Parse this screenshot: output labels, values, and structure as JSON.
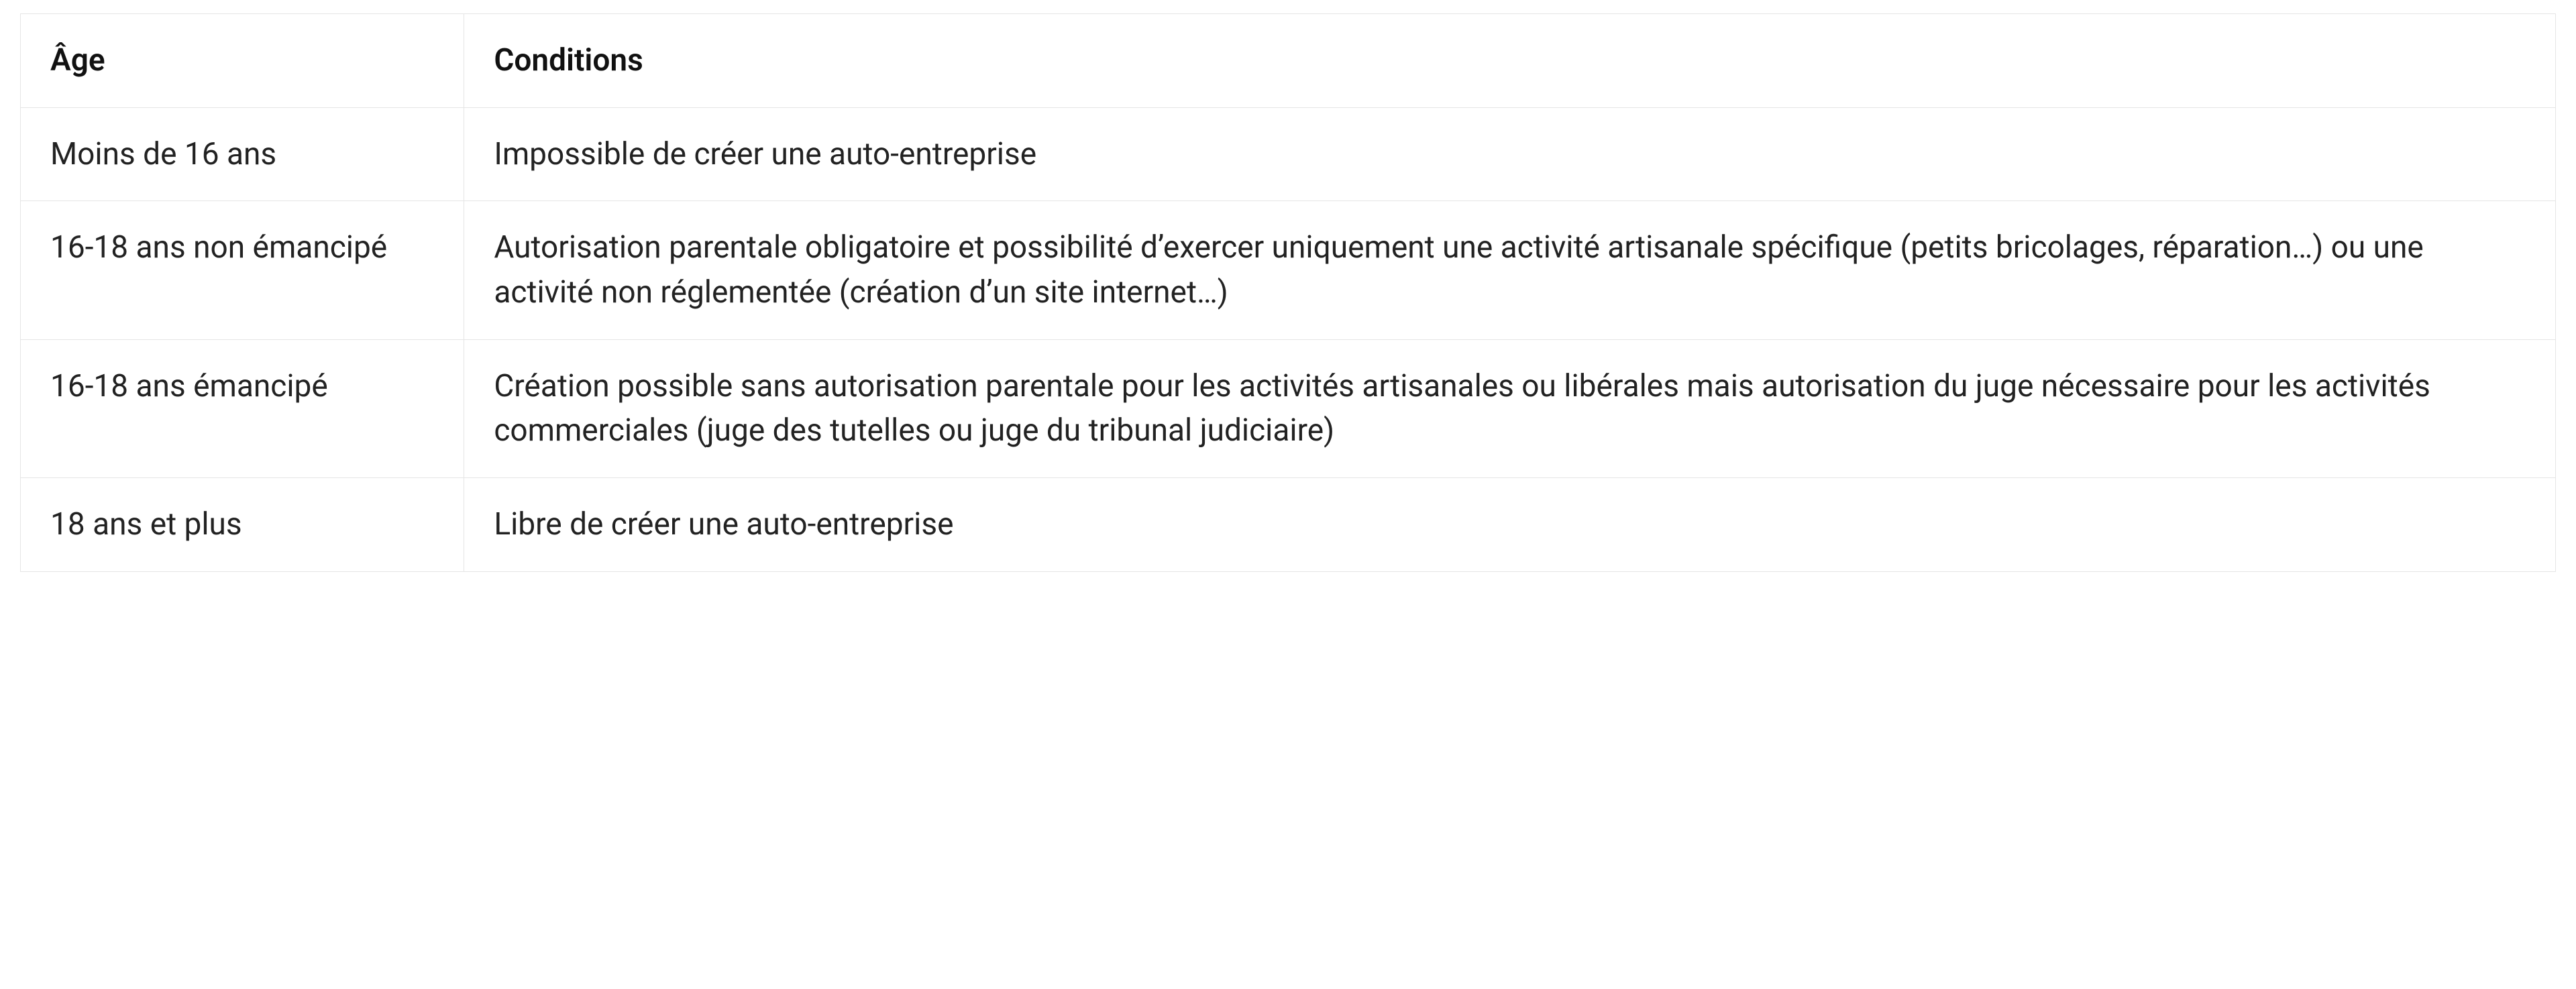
{
  "chart_data": {
    "type": "table",
    "columns": [
      "Âge",
      "Conditions"
    ],
    "rows": [
      [
        "Moins de 16 ans",
        "Impossible de créer une auto-entreprise"
      ],
      [
        "16-18 ans non émancipé",
        "Autorisation parentale obligatoire et possibilité d’exercer uniquement une activité artisanale spécifique (petits bricolages, réparation…) ou une activité non réglementée (création d’un site internet…)"
      ],
      [
        "16-18 ans émancipé",
        "Création possible sans autorisation parentale pour les activités artisanales ou libérales mais autorisation du juge nécessaire pour les activités commerciales (juge des tutelles ou juge du tribunal judiciaire)"
      ],
      [
        "18 ans et plus",
        "Libre de créer une auto-entreprise"
      ]
    ]
  },
  "table": {
    "headers": {
      "age": "Âge",
      "conditions": "Conditions"
    },
    "rows": [
      {
        "age": "Moins de 16 ans",
        "conditions": "Impossible de créer une auto-entreprise"
      },
      {
        "age": "16-18 ans non émancipé",
        "conditions": "Autorisation parentale obligatoire et possibilité d’exercer uniquement une activité artisanale spécifique (petits bricolages, réparation…) ou une activité non réglementée (création d’un site internet…)"
      },
      {
        "age": "16-18 ans émancipé",
        "conditions": "Création possible sans autorisation parentale pour les activités artisanales ou libérales mais autorisation du juge nécessaire pour les activités commerciales (juge des tutelles ou juge du tribunal judiciaire)"
      },
      {
        "age": "18 ans et plus",
        "conditions": "Libre de créer une auto-entreprise"
      }
    ]
  }
}
